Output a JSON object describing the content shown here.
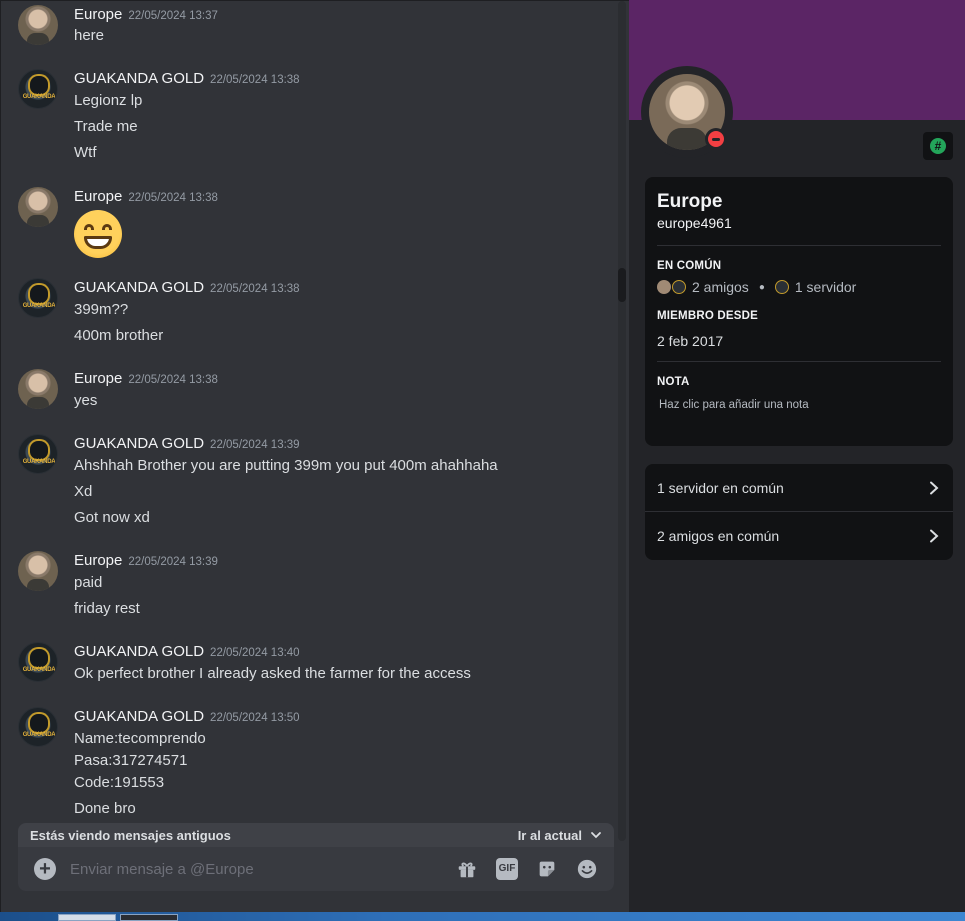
{
  "messages": [
    {
      "author": "Europe",
      "avatar": "europe",
      "time": "22/05/2024 13:37",
      "lines": [
        "here"
      ]
    },
    {
      "author": "GUAKANDA GOLD",
      "avatar": "guakanda",
      "time": "22/05/2024 13:38",
      "lines": [
        "Legionz lp",
        "Trade me",
        "Wtf"
      ]
    },
    {
      "author": "Europe",
      "avatar": "europe",
      "time": "22/05/2024 13:38",
      "emoji": "grinning-face-emoji"
    },
    {
      "author": "GUAKANDA GOLD",
      "avatar": "guakanda",
      "time": "22/05/2024 13:38",
      "lines": [
        "399m??",
        "400m brother"
      ]
    },
    {
      "author": "Europe",
      "avatar": "europe",
      "time": "22/05/2024 13:38",
      "lines": [
        "yes"
      ]
    },
    {
      "author": "GUAKANDA GOLD",
      "avatar": "guakanda",
      "time": "22/05/2024 13:39",
      "lines": [
        "Ahshhah Brother you are putting 399m you put 400m ahahhaha",
        "Xd",
        "Got now xd"
      ]
    },
    {
      "author": "Europe",
      "avatar": "europe",
      "time": "22/05/2024 13:39",
      "lines": [
        "paid",
        "friday rest"
      ]
    },
    {
      "author": "GUAKANDA GOLD",
      "avatar": "guakanda",
      "time": "22/05/2024 13:40",
      "lines": [
        "Ok perfect brother I already asked the farmer for the access"
      ]
    },
    {
      "author": "GUAKANDA GOLD",
      "avatar": "guakanda",
      "time": "22/05/2024 13:50",
      "lines": [
        "Name:tecomprendo",
        "Pasa:317274571",
        "Code:191553",
        "Done bro"
      ]
    }
  ],
  "old_messages_bar": {
    "text": "Estás viendo mensajes antiguos",
    "jump_label": "Ir al actual"
  },
  "composer": {
    "placeholder": "Enviar mensaje a @Europe",
    "icons": [
      "gift-icon",
      "gif-icon",
      "sticker-icon",
      "emoji-icon"
    ],
    "gif_label": "GIF"
  },
  "profile": {
    "display_name": "Europe",
    "username": "europe4961",
    "status": "do-not-disturb",
    "banner_color": "#5b2565",
    "common_title": "EN COMÚN",
    "common_friends": "2 amigos",
    "common_servers": "1 servidor",
    "member_since_title": "MIEMBRO DESDE",
    "member_since": "2 feb 2017",
    "note_title": "NOTA",
    "note_placeholder": "Haz clic para añadir una nota",
    "mutual_servers": "1 servidor en común",
    "mutual_friends": "2 amigos en común"
  }
}
